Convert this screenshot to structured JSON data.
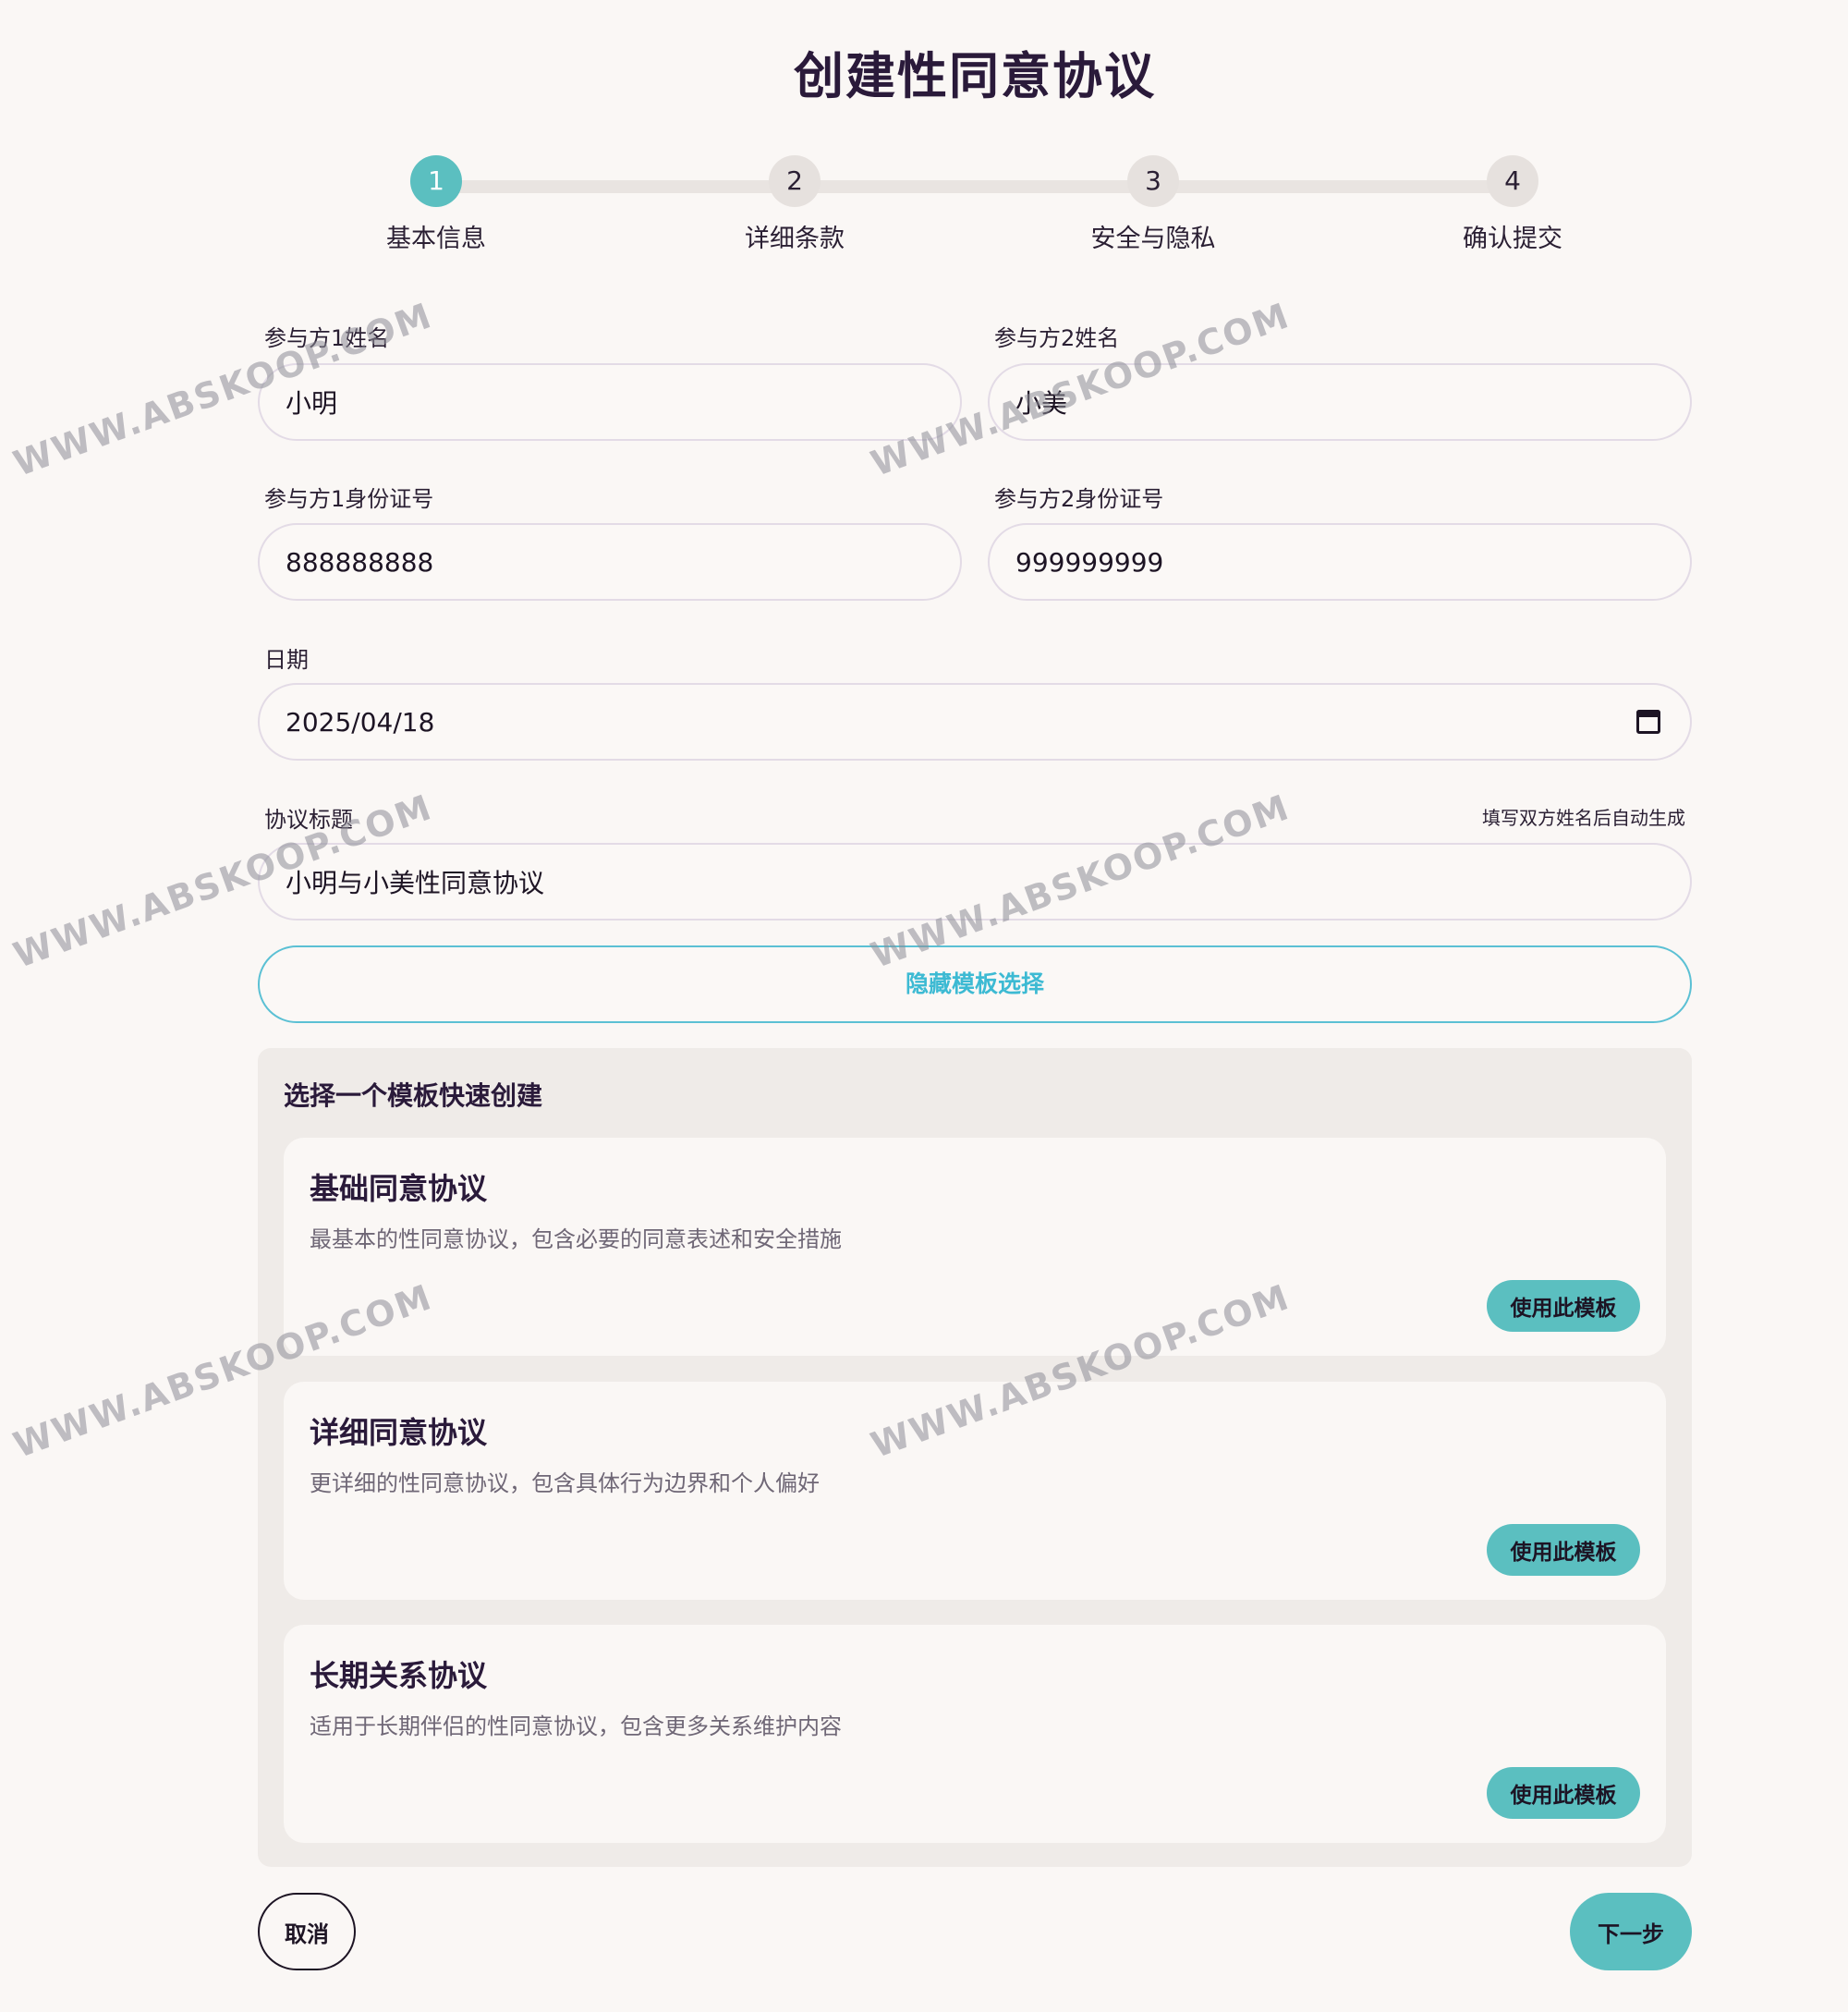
{
  "page": {
    "title": "创建性同意协议"
  },
  "stepper": {
    "steps": [
      {
        "number": "1",
        "label": "基本信息",
        "active": true
      },
      {
        "number": "2",
        "label": "详细条款",
        "active": false
      },
      {
        "number": "3",
        "label": "安全与隐私",
        "active": false
      },
      {
        "number": "4",
        "label": "确认提交",
        "active": false
      }
    ]
  },
  "form": {
    "party1_name": {
      "label": "参与方1姓名",
      "value": "小明"
    },
    "party2_name": {
      "label": "参与方2姓名",
      "value": "小美"
    },
    "party1_id": {
      "label": "参与方1身份证号",
      "value": "888888888"
    },
    "party2_id": {
      "label": "参与方2身份证号",
      "value": "999999999"
    },
    "date": {
      "label": "日期",
      "value": "2025/04/18"
    },
    "agreement_title": {
      "label": "协议标题",
      "hint": "填写双方姓名后自动生成",
      "value": "小明与小美性同意协议"
    }
  },
  "templates": {
    "toggle_label": "隐藏模板选择",
    "panel_title": "选择一个模板快速创建",
    "items": [
      {
        "title": "基础同意协议",
        "description": "最基本的性同意协议，包含必要的同意表述和安全措施",
        "button": "使用此模板"
      },
      {
        "title": "详细同意协议",
        "description": "更详细的性同意协议，包含具体行为边界和个人偏好",
        "button": "使用此模板"
      },
      {
        "title": "长期关系协议",
        "description": "适用于长期伴侣的性同意协议，包含更多关系维护内容",
        "button": "使用此模板"
      }
    ]
  },
  "actions": {
    "cancel": "取消",
    "next": "下一步"
  },
  "watermark": {
    "text": "WWW.ABSKOOP.COM"
  },
  "colors": {
    "accent": "#5bbfc0",
    "link": "#3dbad3",
    "background": "#faf7f5",
    "panel": "#efebe8"
  },
  "icons": {
    "date_picker": "calendar-icon"
  }
}
